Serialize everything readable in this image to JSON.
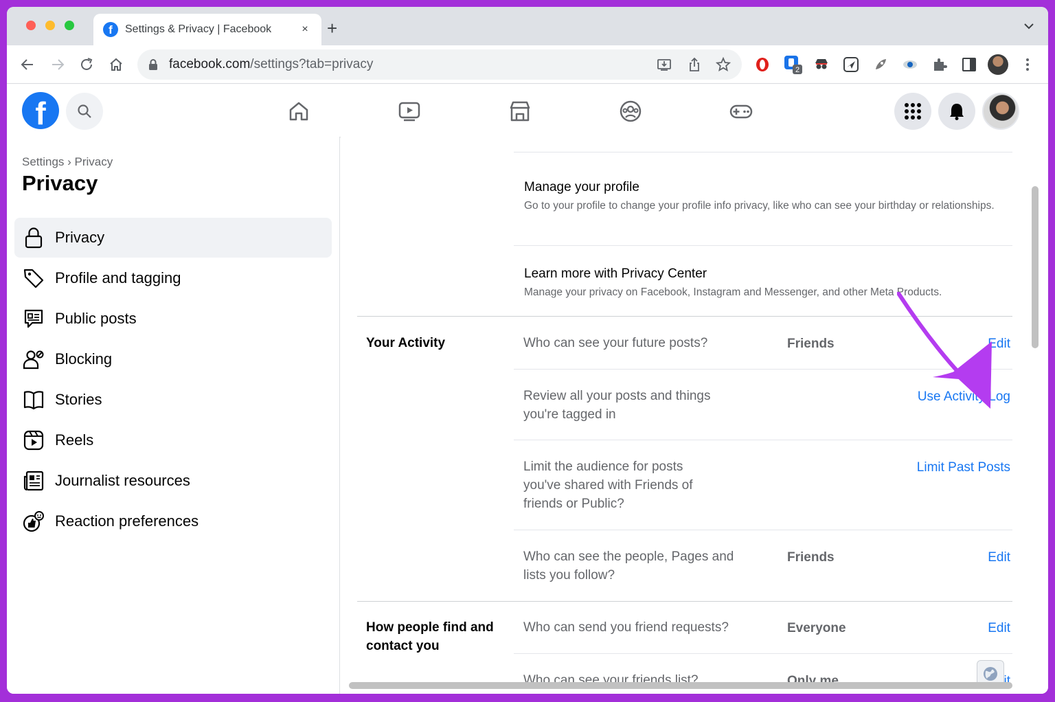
{
  "browser": {
    "tab_title": "Settings & Privacy | Facebook",
    "tab_close": "×",
    "new_tab": "+",
    "url_host": "facebook.com",
    "url_path": "/settings?tab=privacy",
    "extension_badge": "2"
  },
  "sidebar": {
    "breadcrumb": "Settings › Privacy",
    "title": "Privacy",
    "items": [
      {
        "label": "Privacy",
        "icon": "lock-icon",
        "active": true
      },
      {
        "label": "Profile and tagging",
        "icon": "tag-icon"
      },
      {
        "label": "Public posts",
        "icon": "public-posts-icon"
      },
      {
        "label": "Blocking",
        "icon": "blocking-icon"
      },
      {
        "label": "Stories",
        "icon": "stories-icon"
      },
      {
        "label": "Reels",
        "icon": "reels-icon"
      },
      {
        "label": "Journalist resources",
        "icon": "journalist-icon"
      },
      {
        "label": "Reaction preferences",
        "icon": "reaction-icon"
      }
    ]
  },
  "main": {
    "manage_profile": {
      "title": "Manage your profile",
      "desc": "Go to your profile to change your profile info privacy, like who can see your birthday or relationships."
    },
    "privacy_center": {
      "title": "Learn more with Privacy Center",
      "desc": "Manage your privacy on Facebook, Instagram and Messenger, and other Meta Products."
    },
    "your_activity": {
      "title": "Your Activity",
      "rows": [
        {
          "question": "Who can see your future posts?",
          "value": "Friends",
          "action": "Edit"
        },
        {
          "question": "Review all your posts and things you're tagged in",
          "value": "",
          "action": "Use Activity Log"
        },
        {
          "question": "Limit the audience for posts you've shared with Friends of friends or Public?",
          "value": "",
          "action": "Limit Past Posts"
        },
        {
          "question": "Who can see the people, Pages and lists you follow?",
          "value": "Friends",
          "action": "Edit"
        }
      ]
    },
    "find_contact": {
      "title": "How people find and contact you",
      "rows": [
        {
          "question": "Who can send you friend requests?",
          "value": "Everyone",
          "action": "Edit"
        },
        {
          "question": "Who can see your friends list?",
          "value": "Only me",
          "action": "Edit"
        }
      ]
    }
  },
  "colors": {
    "facebook_blue": "#1877f2",
    "annotation_arrow": "#b43cf0",
    "frame": "#a32fd9"
  }
}
